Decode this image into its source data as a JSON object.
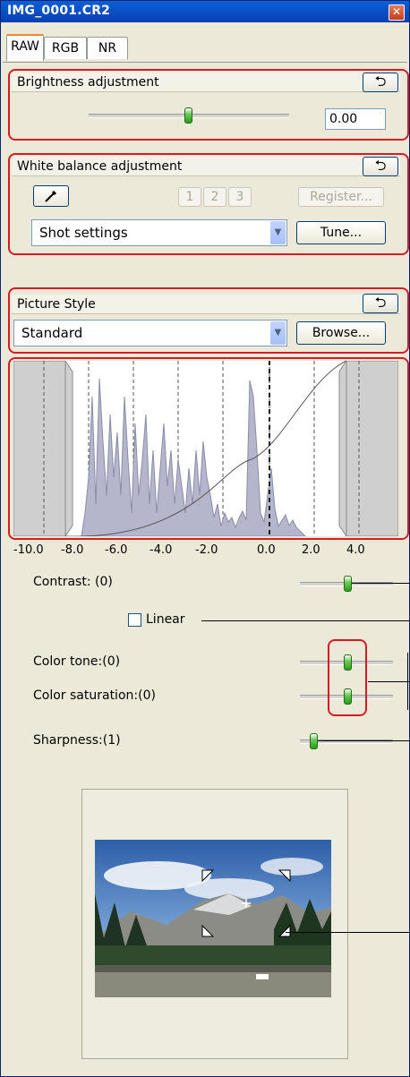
{
  "window": {
    "title": "IMG_0001.CR2",
    "close_glyph": "✕"
  },
  "tabs": [
    {
      "label": "RAW",
      "active": true
    },
    {
      "label": "RGB",
      "active": false
    },
    {
      "label": "NR",
      "active": false
    }
  ],
  "brightness": {
    "header": "Brightness adjustment",
    "value": "0.00",
    "reset_icon": "undo-arrow-icon",
    "slider_fraction": 0.5
  },
  "white_balance": {
    "header": "White balance adjustment",
    "eyedropper_icon": "eyedropper-icon",
    "presets": [
      "1",
      "2",
      "3"
    ],
    "register_label": "Register...",
    "selected": "Shot settings",
    "tune_label": "Tune..."
  },
  "picture_style": {
    "header": "Picture Style",
    "selected": "Standard",
    "browse_label": "Browse..."
  },
  "histogram": {
    "tick_labels": [
      "-10.0",
      "-8.0",
      "-6.0",
      "-4.0",
      "-2.0",
      "0.0",
      "2.0",
      "4.0"
    ]
  },
  "adjustments": {
    "contrast": "Contrast: (0)",
    "linear": "Linear",
    "color_tone": "Color tone:(0)",
    "color_saturation": "Color saturation:(0)",
    "sharpness": "Sharpness:(1)"
  },
  "colors": {
    "highlight": "#d51c24",
    "title_bar": "#0a4fc8",
    "slider_thumb": "#3aaa26"
  }
}
